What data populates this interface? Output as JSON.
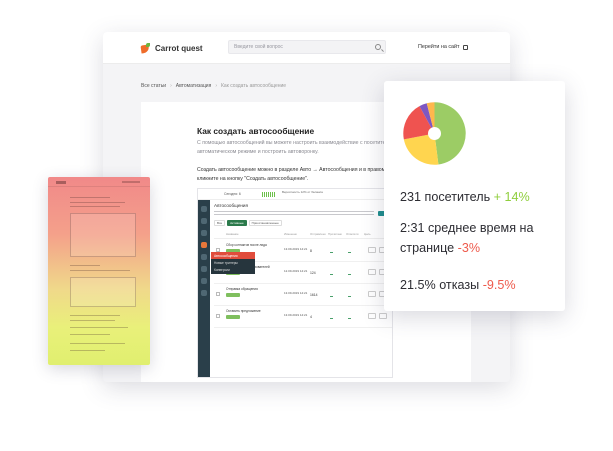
{
  "browser": {
    "logo_text": "Carrot quest",
    "search_placeholder": "Введите свой вопрос",
    "goto_site": "Перейти на сайт",
    "breadcrumbs": [
      "Все статьи",
      "Автоматизация",
      "Как создать автосообщение"
    ],
    "article": {
      "title": "Как создать автосообщение",
      "intro": "С помощью автосообщений вы можете настроить взаимодействие с посетителями в автоматическом режиме и построить автоворонку.",
      "instruction": "Создать автосообщение можно в разделе Авто → Автосообщения и в правом верхнем углу кликните на кнопку \"Создать автосообщение\"."
    },
    "app": {
      "header": "Автосообщения",
      "top_label": "Сегодня: 6",
      "top_stats": "Вероятность 12% от баланса",
      "filters": [
        "Все",
        "Активные",
        "Приостановленные"
      ],
      "columns": [
        "Название",
        "Изменено",
        "Отправлено",
        "Прочитано",
        "Ответили",
        "Цель"
      ],
      "menu": [
        "Автосообщения",
        "Новые триггеры",
        "Конверсии"
      ],
      "rows": [
        {
          "name": "Сбор контактов после лида",
          "date": "13.09.2019 14:21",
          "num": "8"
        },
        {
          "name": "Подбивка для пользователей",
          "date": "12.09.2019 14:21",
          "num": "124"
        },
        {
          "name": "Отправка обращения",
          "date": "13.09.2019 14:21",
          "num": "1614"
        },
        {
          "name": "Оставить предложение",
          "date": "13.09.2019 14:21",
          "num": "4"
        }
      ]
    }
  },
  "stats": {
    "visitors_text": "231 посетитель",
    "visitors_delta": "+ 14%",
    "time_text": "2:31 среднее время на странице",
    "time_delta": "-3%",
    "bounce_text": "21.5% отказы",
    "bounce_delta": "-9.5%",
    "pie": {
      "slices": [
        {
          "value": 48,
          "color": "#9ccc65"
        },
        {
          "value": 24,
          "color": "#ffd54f"
        },
        {
          "value": 20,
          "color": "#ef5350"
        },
        {
          "value": 4,
          "color": "#7e57c2"
        },
        {
          "value": 4,
          "color": "#ffb74d"
        }
      ]
    },
    "colors": {
      "up": "#8fce3d",
      "down": "#ee5a4c"
    }
  }
}
